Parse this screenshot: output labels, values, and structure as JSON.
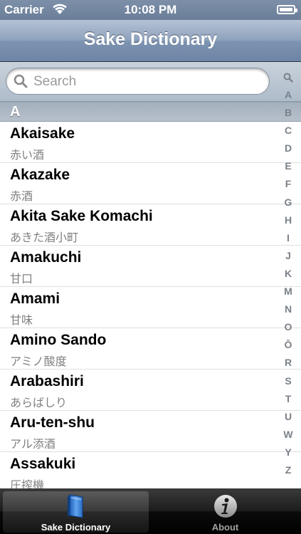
{
  "status_bar": {
    "carrier": "Carrier",
    "time": "10:08 PM"
  },
  "nav": {
    "title": "Sake Dictionary"
  },
  "search": {
    "placeholder": "Search"
  },
  "section": {
    "header": "A"
  },
  "entries": [
    {
      "title": "Akaisake",
      "sub": "赤い酒"
    },
    {
      "title": "Akazake",
      "sub": "赤酒"
    },
    {
      "title": "Akita Sake Komachi",
      "sub": "あきた酒小町"
    },
    {
      "title": "Amakuchi",
      "sub": "甘口"
    },
    {
      "title": "Amami",
      "sub": "甘味"
    },
    {
      "title": "Amino Sando",
      "sub": "アミノ酸度"
    },
    {
      "title": "Arabashiri",
      "sub": "あらばしり"
    },
    {
      "title": "Aru-ten-shu",
      "sub": "アル添酒"
    },
    {
      "title": "Assakuki",
      "sub": "圧搾機"
    }
  ],
  "index": [
    "A",
    "B",
    "C",
    "D",
    "E",
    "F",
    "G",
    "H",
    "I",
    "J",
    "K",
    "M",
    "N",
    "O",
    "Ō",
    "R",
    "S",
    "T",
    "U",
    "W",
    "Y",
    "Z"
  ],
  "tabs": [
    {
      "label": "Sake Dictionary",
      "icon": "book-icon",
      "selected": true
    },
    {
      "label": "About",
      "icon": "info-icon",
      "selected": false
    }
  ]
}
